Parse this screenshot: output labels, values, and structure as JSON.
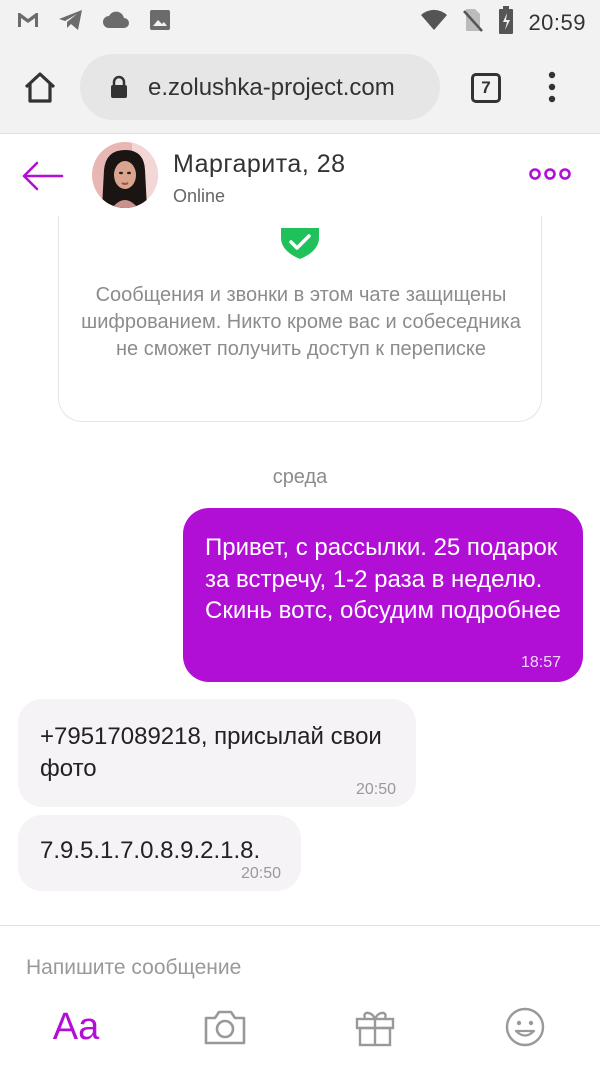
{
  "status_bar": {
    "time": "20:59",
    "left_icons": [
      "gmail-icon",
      "telegram-icon",
      "cloud-icon",
      "image-icon"
    ],
    "right_icons": [
      "wifi-icon",
      "no-sim-icon",
      "battery-charging-icon"
    ]
  },
  "browser": {
    "url": "e.zolushka-project.com",
    "tab_count": "7"
  },
  "chat": {
    "peer_name": "Маргарита, 28",
    "peer_status": "Online"
  },
  "encryption_notice": "Сообщения и звонки в этом чате защищены шифрованием. Никто кроме вас и собеседника не сможет получить доступ к переписке",
  "day_separator": "среда",
  "messages": [
    {
      "direction": "out",
      "text": "Привет, с рассылки. 25 подарок за встречу, 1-2 раза в неделю. Скинь вотс, обсудим подробнее",
      "time": "18:57"
    },
    {
      "direction": "in",
      "text": "+79517089218, присылай свои фото",
      "time": "20:50"
    },
    {
      "direction": "in",
      "text": "7.9.5.1.7.0.8.9.2.1.8.",
      "time": "20:50"
    }
  ],
  "composer": {
    "placeholder": "Напишите сообщение",
    "format_label": "Aa"
  },
  "colors": {
    "accent": "#b20fd6",
    "shield_green": "#1fc25a",
    "incoming_bubble": "#f6f3f7"
  }
}
